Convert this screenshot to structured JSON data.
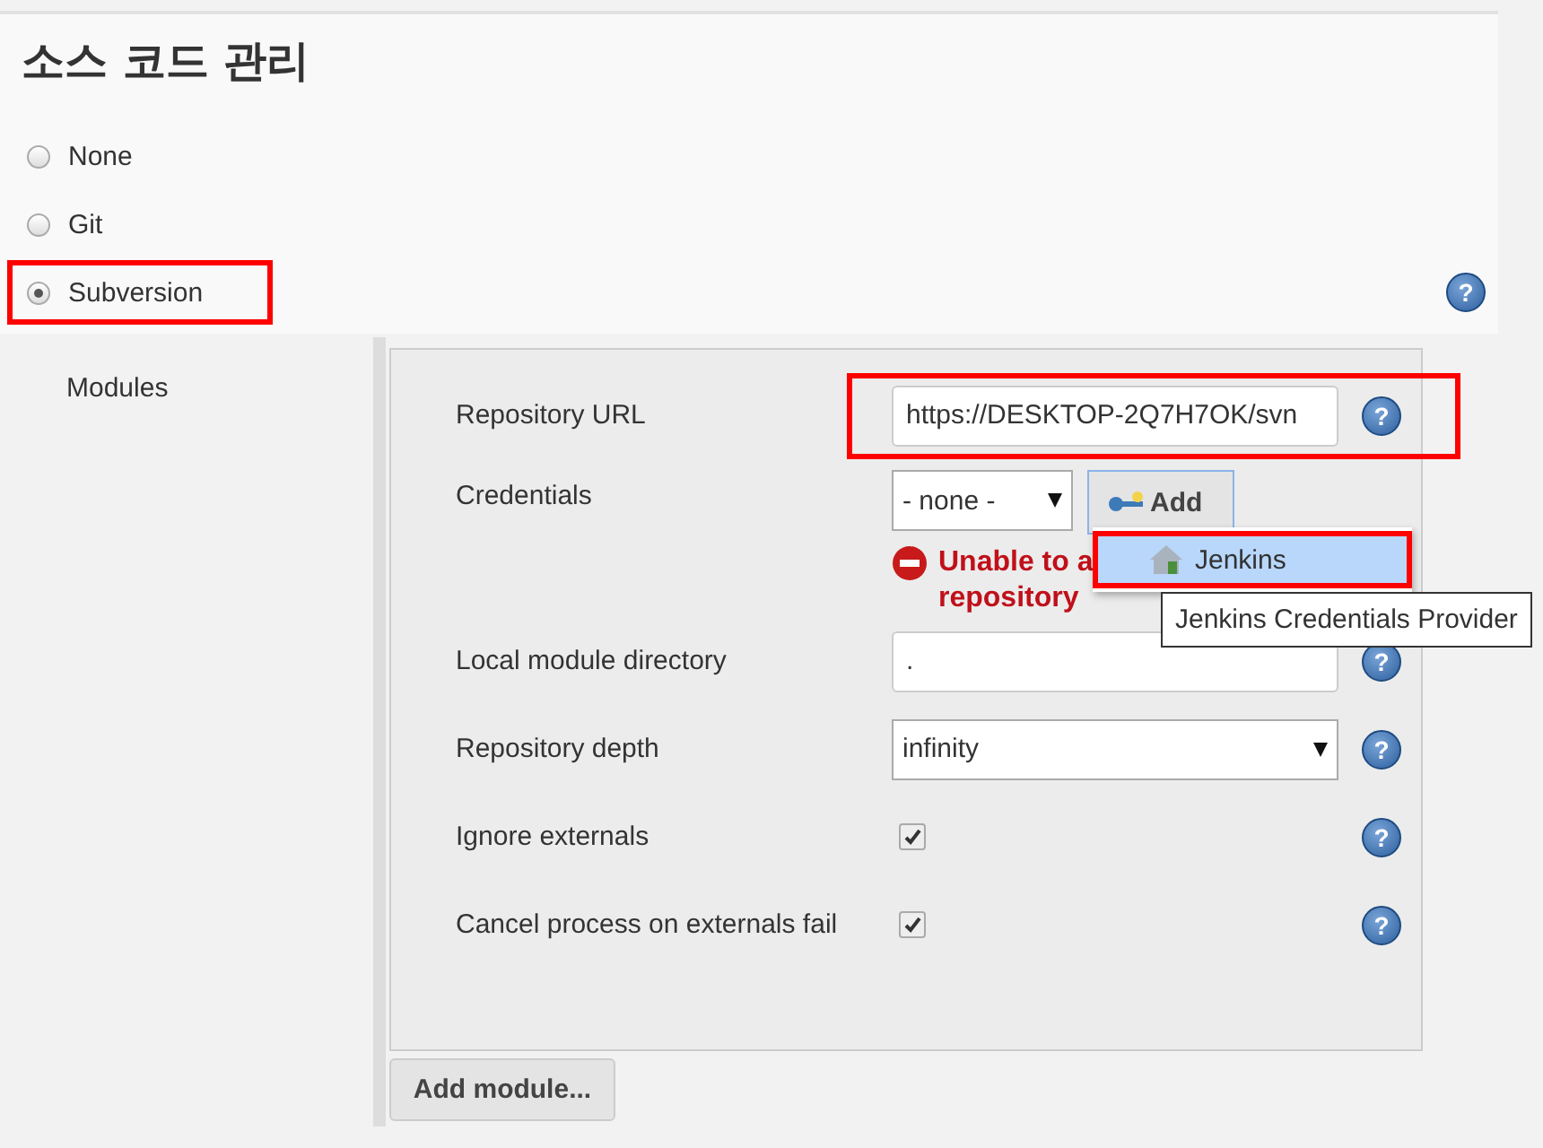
{
  "section_title": "소스 코드 관리",
  "help_icon": "?",
  "scm_options": [
    {
      "label": "None",
      "selected": false,
      "highlighted": false
    },
    {
      "label": "Git",
      "selected": false,
      "highlighted": false
    },
    {
      "label": "Subversion",
      "selected": true,
      "highlighted": true
    }
  ],
  "modules_label": "Modules",
  "module": {
    "repository_url": {
      "label": "Repository URL",
      "value": "https://DESKTOP-2Q7H7OK/svn",
      "highlighted": true
    },
    "credentials": {
      "label": "Credentials",
      "value": "- none -",
      "add_button": "Add",
      "menu": [
        {
          "label": "Jenkins",
          "selected": true,
          "highlighted": true
        }
      ],
      "tooltip": "Jenkins Credentials Provider",
      "error_lines": [
        "Unable to a",
        "repository"
      ]
    },
    "local_directory": {
      "label": "Local module directory",
      "value": "."
    },
    "depth": {
      "label": "Repository depth",
      "value": "infinity"
    },
    "checks": [
      {
        "label": "Ignore externals",
        "checked": true
      },
      {
        "label": "Cancel process on externals fail",
        "checked": true
      }
    ]
  },
  "add_module_button": "Add module..."
}
